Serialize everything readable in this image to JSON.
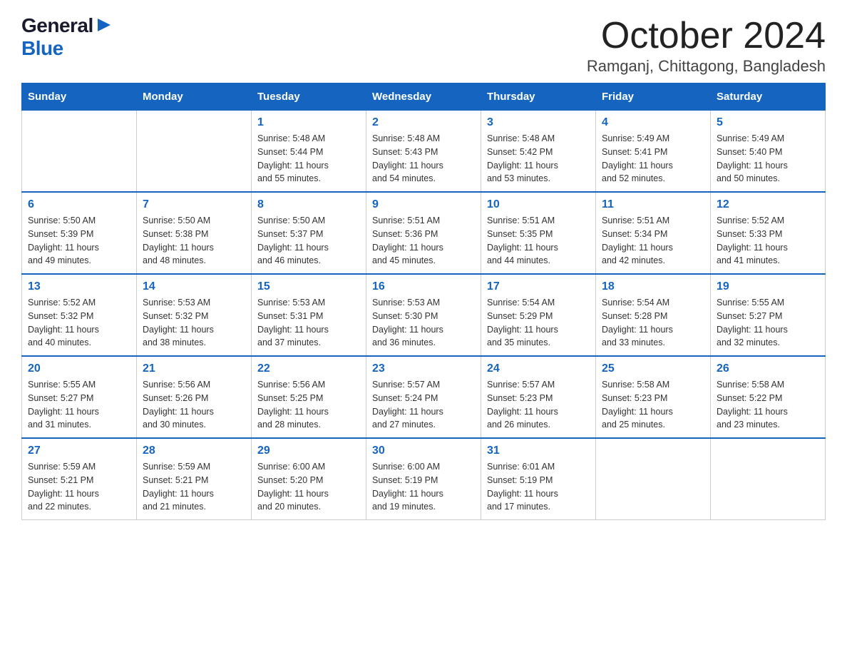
{
  "logo": {
    "general": "General",
    "blue": "Blue"
  },
  "title": "October 2024",
  "location": "Ramganj, Chittagong, Bangladesh",
  "weekdays": [
    "Sunday",
    "Monday",
    "Tuesday",
    "Wednesday",
    "Thursday",
    "Friday",
    "Saturday"
  ],
  "weeks": [
    [
      {
        "day": "",
        "info": ""
      },
      {
        "day": "",
        "info": ""
      },
      {
        "day": "1",
        "info": "Sunrise: 5:48 AM\nSunset: 5:44 PM\nDaylight: 11 hours\nand 55 minutes."
      },
      {
        "day": "2",
        "info": "Sunrise: 5:48 AM\nSunset: 5:43 PM\nDaylight: 11 hours\nand 54 minutes."
      },
      {
        "day": "3",
        "info": "Sunrise: 5:48 AM\nSunset: 5:42 PM\nDaylight: 11 hours\nand 53 minutes."
      },
      {
        "day": "4",
        "info": "Sunrise: 5:49 AM\nSunset: 5:41 PM\nDaylight: 11 hours\nand 52 minutes."
      },
      {
        "day": "5",
        "info": "Sunrise: 5:49 AM\nSunset: 5:40 PM\nDaylight: 11 hours\nand 50 minutes."
      }
    ],
    [
      {
        "day": "6",
        "info": "Sunrise: 5:50 AM\nSunset: 5:39 PM\nDaylight: 11 hours\nand 49 minutes."
      },
      {
        "day": "7",
        "info": "Sunrise: 5:50 AM\nSunset: 5:38 PM\nDaylight: 11 hours\nand 48 minutes."
      },
      {
        "day": "8",
        "info": "Sunrise: 5:50 AM\nSunset: 5:37 PM\nDaylight: 11 hours\nand 46 minutes."
      },
      {
        "day": "9",
        "info": "Sunrise: 5:51 AM\nSunset: 5:36 PM\nDaylight: 11 hours\nand 45 minutes."
      },
      {
        "day": "10",
        "info": "Sunrise: 5:51 AM\nSunset: 5:35 PM\nDaylight: 11 hours\nand 44 minutes."
      },
      {
        "day": "11",
        "info": "Sunrise: 5:51 AM\nSunset: 5:34 PM\nDaylight: 11 hours\nand 42 minutes."
      },
      {
        "day": "12",
        "info": "Sunrise: 5:52 AM\nSunset: 5:33 PM\nDaylight: 11 hours\nand 41 minutes."
      }
    ],
    [
      {
        "day": "13",
        "info": "Sunrise: 5:52 AM\nSunset: 5:32 PM\nDaylight: 11 hours\nand 40 minutes."
      },
      {
        "day": "14",
        "info": "Sunrise: 5:53 AM\nSunset: 5:32 PM\nDaylight: 11 hours\nand 38 minutes."
      },
      {
        "day": "15",
        "info": "Sunrise: 5:53 AM\nSunset: 5:31 PM\nDaylight: 11 hours\nand 37 minutes."
      },
      {
        "day": "16",
        "info": "Sunrise: 5:53 AM\nSunset: 5:30 PM\nDaylight: 11 hours\nand 36 minutes."
      },
      {
        "day": "17",
        "info": "Sunrise: 5:54 AM\nSunset: 5:29 PM\nDaylight: 11 hours\nand 35 minutes."
      },
      {
        "day": "18",
        "info": "Sunrise: 5:54 AM\nSunset: 5:28 PM\nDaylight: 11 hours\nand 33 minutes."
      },
      {
        "day": "19",
        "info": "Sunrise: 5:55 AM\nSunset: 5:27 PM\nDaylight: 11 hours\nand 32 minutes."
      }
    ],
    [
      {
        "day": "20",
        "info": "Sunrise: 5:55 AM\nSunset: 5:27 PM\nDaylight: 11 hours\nand 31 minutes."
      },
      {
        "day": "21",
        "info": "Sunrise: 5:56 AM\nSunset: 5:26 PM\nDaylight: 11 hours\nand 30 minutes."
      },
      {
        "day": "22",
        "info": "Sunrise: 5:56 AM\nSunset: 5:25 PM\nDaylight: 11 hours\nand 28 minutes."
      },
      {
        "day": "23",
        "info": "Sunrise: 5:57 AM\nSunset: 5:24 PM\nDaylight: 11 hours\nand 27 minutes."
      },
      {
        "day": "24",
        "info": "Sunrise: 5:57 AM\nSunset: 5:23 PM\nDaylight: 11 hours\nand 26 minutes."
      },
      {
        "day": "25",
        "info": "Sunrise: 5:58 AM\nSunset: 5:23 PM\nDaylight: 11 hours\nand 25 minutes."
      },
      {
        "day": "26",
        "info": "Sunrise: 5:58 AM\nSunset: 5:22 PM\nDaylight: 11 hours\nand 23 minutes."
      }
    ],
    [
      {
        "day": "27",
        "info": "Sunrise: 5:59 AM\nSunset: 5:21 PM\nDaylight: 11 hours\nand 22 minutes."
      },
      {
        "day": "28",
        "info": "Sunrise: 5:59 AM\nSunset: 5:21 PM\nDaylight: 11 hours\nand 21 minutes."
      },
      {
        "day": "29",
        "info": "Sunrise: 6:00 AM\nSunset: 5:20 PM\nDaylight: 11 hours\nand 20 minutes."
      },
      {
        "day": "30",
        "info": "Sunrise: 6:00 AM\nSunset: 5:19 PM\nDaylight: 11 hours\nand 19 minutes."
      },
      {
        "day": "31",
        "info": "Sunrise: 6:01 AM\nSunset: 5:19 PM\nDaylight: 11 hours\nand 17 minutes."
      },
      {
        "day": "",
        "info": ""
      },
      {
        "day": "",
        "info": ""
      }
    ]
  ]
}
